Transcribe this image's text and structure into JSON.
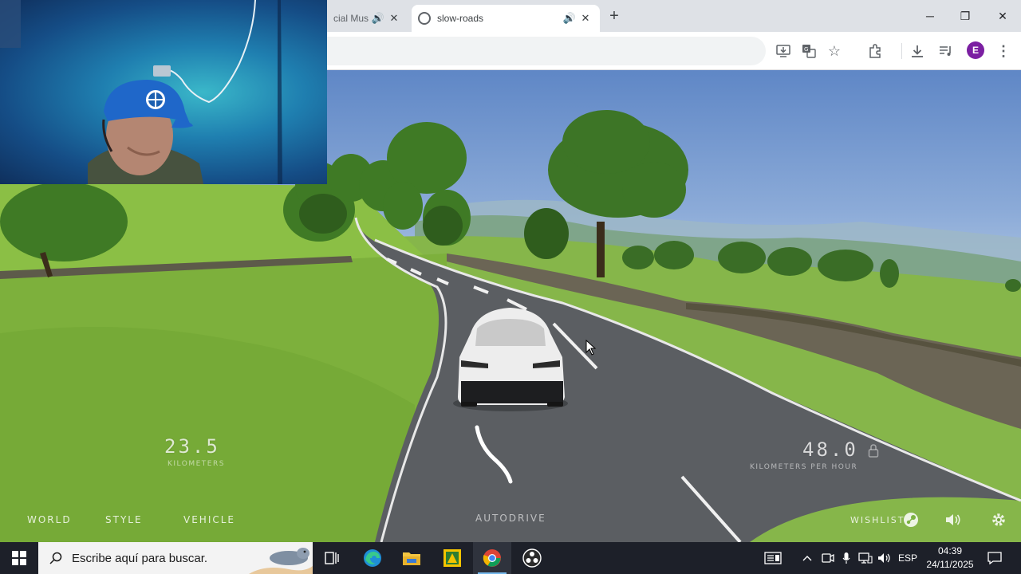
{
  "browser": {
    "tabs": [
      {
        "title": "cial Mus",
        "active": false
      },
      {
        "title": "slow-roads",
        "active": true
      }
    ],
    "new_tab_symbol": "+",
    "window_controls": {
      "minimize": "─",
      "restore": "❐",
      "close": "✕"
    },
    "profile_initial": "E",
    "toolbar_icons": [
      "install-app-icon",
      "translate-icon",
      "bookmark-star-icon",
      "extensions-icon",
      "downloads-icon",
      "media-control-icon",
      "menu-dots-icon"
    ]
  },
  "game": {
    "distance": {
      "value": "23.5",
      "unit": "KILOMETERS"
    },
    "speed": {
      "value": "48.0",
      "unit": "KILOMETERS PER HOUR"
    },
    "menu": {
      "world": "WORLD",
      "style": "STYLE",
      "vehicle": "VEHICLE"
    },
    "autodrive": "AUTODRIVE",
    "wishlist": "WISHLIST"
  },
  "taskbar": {
    "search_placeholder": "Escribe aquí para buscar.",
    "apps": [
      "task-view",
      "edge",
      "file-explorer",
      "app-yellow",
      "chrome",
      "obs"
    ],
    "active_app": "chrome",
    "language": "ESP",
    "time": "04:39",
    "date": "24/11/2025"
  },
  "colors": {
    "accent_profile": "#7b1fa2",
    "taskbar_bg": "#1d2029",
    "sky": "#8cabd8",
    "grass": "#7cb342",
    "road": "#5b5e62"
  }
}
